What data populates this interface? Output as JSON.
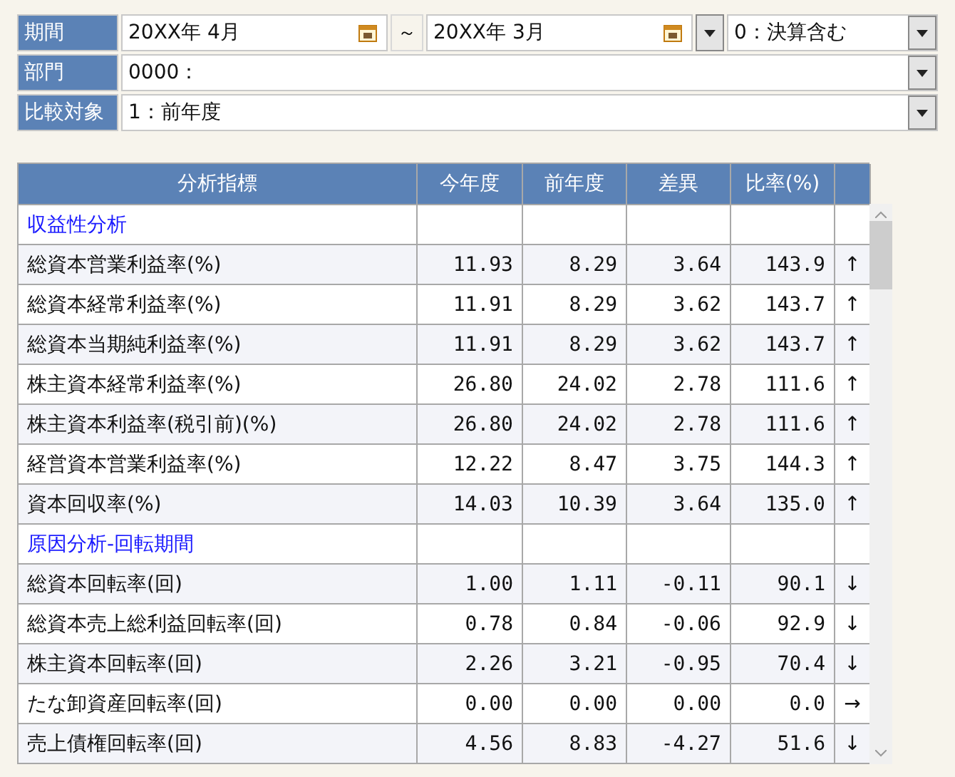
{
  "filters": {
    "period": {
      "label": "期間",
      "from": "20XX年 4月",
      "separator": "～",
      "to": "20XX年 3月",
      "mode": "0：決算含む"
    },
    "department": {
      "label": "部門",
      "value": "0000："
    },
    "comparison": {
      "label": "比較対象",
      "value": "1：前年度"
    }
  },
  "table": {
    "columns": [
      "分析指標",
      "今年度",
      "前年度",
      "差異",
      "比率(%)"
    ],
    "rows": [
      {
        "kind": "section",
        "name": "収益性分析"
      },
      {
        "kind": "data",
        "name": "総資本営業利益率(%)",
        "current": "11.93",
        "previous": "8.29",
        "diff": "3.64",
        "ratio": "143.9",
        "trend": "↑"
      },
      {
        "kind": "data",
        "name": "総資本経常利益率(%)",
        "current": "11.91",
        "previous": "8.29",
        "diff": "3.62",
        "ratio": "143.7",
        "trend": "↑"
      },
      {
        "kind": "data",
        "name": "総資本当期純利益率(%)",
        "current": "11.91",
        "previous": "8.29",
        "diff": "3.62",
        "ratio": "143.7",
        "trend": "↑"
      },
      {
        "kind": "data",
        "name": "株主資本経常利益率(%)",
        "current": "26.80",
        "previous": "24.02",
        "diff": "2.78",
        "ratio": "111.6",
        "trend": "↑"
      },
      {
        "kind": "data",
        "name": "株主資本利益率(税引前)(%)",
        "current": "26.80",
        "previous": "24.02",
        "diff": "2.78",
        "ratio": "111.6",
        "trend": "↑"
      },
      {
        "kind": "data",
        "name": "経営資本営業利益率(%)",
        "current": "12.22",
        "previous": "8.47",
        "diff": "3.75",
        "ratio": "144.3",
        "trend": "↑"
      },
      {
        "kind": "data",
        "name": "資本回収率(%)",
        "current": "14.03",
        "previous": "10.39",
        "diff": "3.64",
        "ratio": "135.0",
        "trend": "↑"
      },
      {
        "kind": "section",
        "name": "原因分析-回転期間"
      },
      {
        "kind": "data",
        "name": "総資本回転率(回)",
        "current": "1.00",
        "previous": "1.11",
        "diff": "-0.11",
        "ratio": "90.1",
        "trend": "↓"
      },
      {
        "kind": "data",
        "name": "総資本売上総利益回転率(回)",
        "current": "0.78",
        "previous": "0.84",
        "diff": "-0.06",
        "ratio": "92.9",
        "trend": "↓"
      },
      {
        "kind": "data",
        "name": "株主資本回転率(回)",
        "current": "2.26",
        "previous": "3.21",
        "diff": "-0.95",
        "ratio": "70.4",
        "trend": "↓"
      },
      {
        "kind": "data",
        "name": "たな卸資産回転率(回)",
        "current": "0.00",
        "previous": "0.00",
        "diff": "0.00",
        "ratio": "0.0",
        "trend": "→"
      },
      {
        "kind": "data",
        "name": "売上債権回転率(回)",
        "current": "4.56",
        "previous": "8.83",
        "diff": "-4.27",
        "ratio": "51.6",
        "trend": "↓"
      }
    ]
  }
}
